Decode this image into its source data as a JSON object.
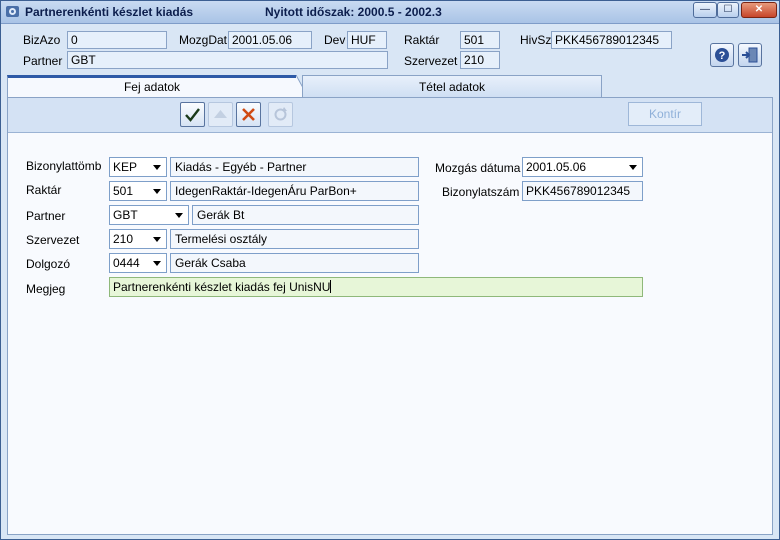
{
  "window": {
    "title": "Partnerenkénti készlet kiadás",
    "period": "Nyitott időszak: 2000.5 - 2002.3",
    "minimize": "—",
    "maximize": "☐",
    "close": "✕"
  },
  "header": {
    "bizazo_label": "BizAzo",
    "bizazo_value": "0",
    "mozgdat_label": "MozgDat",
    "mozgdat_value": "2001.05.06",
    "dev_label": "Dev",
    "dev_value": "HUF",
    "raktar_label": "Raktár",
    "raktar_value": "501",
    "hivsz_label": "HivSz",
    "hivsz_value": "PKK456789012345",
    "partner_label": "Partner",
    "partner_value": "GBT",
    "szervezet_label": "Szervezet",
    "szervezet_value": "210"
  },
  "tabs": [
    {
      "label": "Fej adatok",
      "active": true
    },
    {
      "label": "Tétel adatok",
      "active": false
    }
  ],
  "toolbar": {
    "kontir_label": "Kontír"
  },
  "form": {
    "bizonylattomb": {
      "label": "Bizonylattömb",
      "code": "KEP",
      "desc": "Kiadás - Egyéb - Partner"
    },
    "raktar": {
      "label": "Raktár",
      "code": "501",
      "desc": "IdegenRaktár-IdegenÁru ParBon+"
    },
    "partner": {
      "label": "Partner",
      "code": "GBT",
      "desc": "Gerák Bt"
    },
    "szervezet": {
      "label": "Szervezet",
      "code": "210",
      "desc": "Termelési osztály"
    },
    "dolgozo": {
      "label": "Dolgozó",
      "code": "0444",
      "desc": "Gerák Csaba"
    },
    "megjeg": {
      "label": "Megjeg",
      "value": "Partnerenkénti készlet kiadás fej UnisNU"
    },
    "mozgas_datuma": {
      "label": "Mozgás dátuma",
      "value": "2001.05.06"
    },
    "bizonylatszam": {
      "label": "Bizonylatszám",
      "value": "PKK456789012345"
    }
  },
  "colors": {
    "accent": "#2e5aa7",
    "megjeg_bg": "#e7f6d8"
  }
}
